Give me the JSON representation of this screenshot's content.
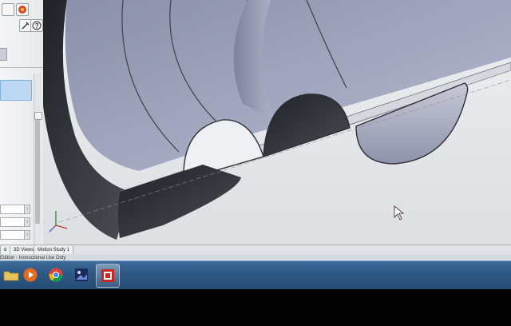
{
  "app": {
    "status_text": "Edition - Instructional Use Only"
  },
  "bottom_tabs": [
    {
      "label": "d"
    },
    {
      "label": "3D Views"
    },
    {
      "label": "Motion Study 1"
    }
  ],
  "left_panel": {
    "toolbar_icons": [
      "part-icon",
      "appearance-icon",
      "options-icon",
      "help-icon"
    ]
  },
  "viewport": {
    "background_top": "#eeeff1",
    "background_bottom": "#dcdee2",
    "surface_color": "#9a9fb7",
    "shadow_color": "#2b2d33",
    "cursor": "pointer-arrow-icon"
  },
  "taskbar": {
    "items": [
      {
        "name": "file-explorer-icon",
        "active": false
      },
      {
        "name": "media-player-icon",
        "active": false
      },
      {
        "name": "chrome-icon",
        "active": false
      },
      {
        "name": "image-app-icon",
        "active": false
      },
      {
        "name": "solidworks-icon",
        "active": true
      }
    ]
  }
}
